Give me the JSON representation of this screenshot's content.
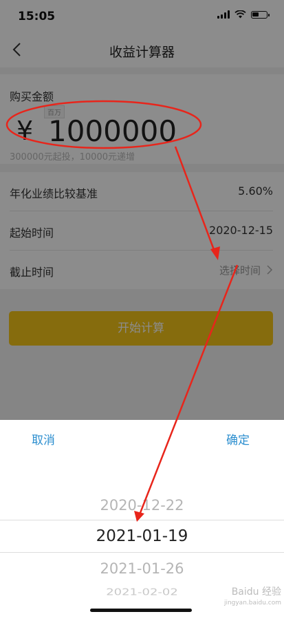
{
  "status": {
    "time": "15:05"
  },
  "nav": {
    "title": "收益计算器"
  },
  "amount": {
    "label": "购买金额",
    "unit_badge": "百万",
    "currency": "¥",
    "value": "1000000",
    "hint": "300000元起投，10000元递增"
  },
  "rows": [
    {
      "label": "年化业绩比较基准",
      "value": "5.60%"
    },
    {
      "label": "起始时间",
      "value": "2020-12-15"
    },
    {
      "label": "截止时间",
      "value": "选择时间"
    }
  ],
  "calc_button": "开始计算",
  "picker": {
    "cancel": "取消",
    "confirm": "确定",
    "options": [
      "2020-12-22",
      "2021-01-19",
      "2021-01-26",
      "2021-02-02"
    ],
    "selected_index": 1
  },
  "watermark": {
    "line1": "Baidu 经验",
    "line2": "jingyan.baidu.com"
  },
  "colors": {
    "accent_button": "#f5c518",
    "link": "#2b8ecf",
    "annotation": "#e8251b"
  }
}
